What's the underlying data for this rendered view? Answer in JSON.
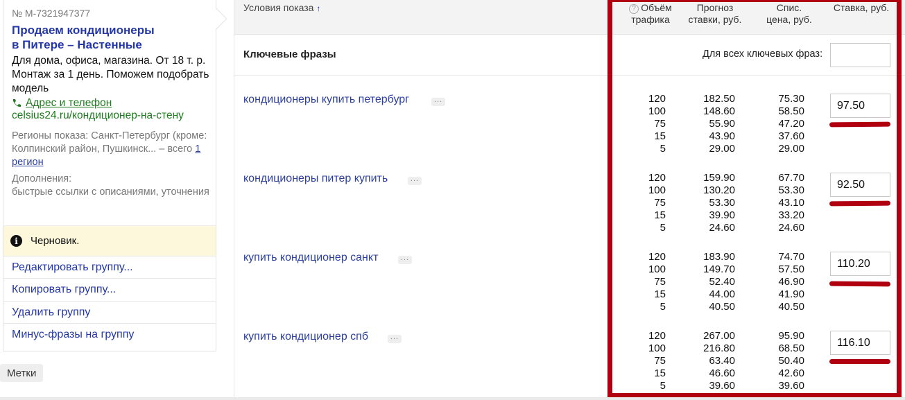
{
  "ad": {
    "number": "№ M-7321947377",
    "title_line1": "Продаем кондиционеры",
    "title_line2": "в Питере – Настенные",
    "text": "Для дома, офиса, магазина. От 18 т. р. Монтаж за 1 день. Поможем подобрать модель",
    "contact_label": "Адрес и телефон",
    "url": "celsius24.ru/кондиционер-на-стену",
    "regions_prefix": "Регионы показа: Санкт-Петербург (кроме: Колпинский район, Пушкинск... – всего ",
    "regions_link": "1 регион",
    "extras_title": "Дополнения:",
    "extras_value": "быстрые ссылки с описаниями, уточнения",
    "draft_status": "Черновик.",
    "actions": [
      "Редактировать группу...",
      "Копировать группу...",
      "Удалить группу",
      "Минус-фразы на группу"
    ],
    "tags_button": "Метки"
  },
  "table": {
    "header": {
      "conditions": "Условия показа",
      "sort_arrow": "↑",
      "traffic_l1": "Объём",
      "traffic_l2": "трафика",
      "forecast_l1": "Прогноз",
      "forecast_l2": "ставки, руб.",
      "charge_l1": "Спис.",
      "charge_l2": "цена, руб.",
      "bid": "Ставка, руб."
    },
    "keywords_title": "Ключевые фразы",
    "all_keywords_label": "Для всех ключевых фраз:",
    "all_keywords_value": "",
    "rows": [
      {
        "phrase": "кондиционеры купить петербург",
        "traffic": [
          "120",
          "100",
          "75",
          "15",
          "5"
        ],
        "forecast": [
          "182.50",
          "148.60",
          "55.90",
          "43.90",
          "29.00"
        ],
        "charge": [
          "75.30",
          "58.50",
          "47.20",
          "37.60",
          "29.00"
        ],
        "bid": "97.50"
      },
      {
        "phrase": "кондиционеры питер купить",
        "traffic": [
          "120",
          "100",
          "75",
          "15",
          "5"
        ],
        "forecast": [
          "159.90",
          "130.20",
          "53.30",
          "39.90",
          "24.60"
        ],
        "charge": [
          "67.70",
          "53.30",
          "43.10",
          "33.20",
          "24.60"
        ],
        "bid": "92.50"
      },
      {
        "phrase": "купить кондиционер санкт",
        "traffic": [
          "120",
          "100",
          "75",
          "15",
          "5"
        ],
        "forecast": [
          "183.90",
          "149.70",
          "52.40",
          "44.00",
          "40.50"
        ],
        "charge": [
          "74.70",
          "57.50",
          "46.90",
          "41.90",
          "40.50"
        ],
        "bid": "110.20"
      },
      {
        "phrase": "купить кондиционер спб",
        "traffic": [
          "120",
          "100",
          "75",
          "15",
          "5"
        ],
        "forecast": [
          "267.00",
          "216.80",
          "63.40",
          "46.60",
          "39.60"
        ],
        "charge": [
          "95.90",
          "68.50",
          "50.40",
          "42.60",
          "39.60"
        ],
        "bid": "116.10"
      }
    ]
  },
  "colors": {
    "link": "#2437a6",
    "url_green": "#1e7a1e",
    "highlight_red": "#b00010",
    "draft_bg": "#fdf7dc"
  },
  "icons": {
    "phone": "phone-icon",
    "info": "info-icon",
    "help": "question-icon",
    "more": "more-dots-icon"
  }
}
